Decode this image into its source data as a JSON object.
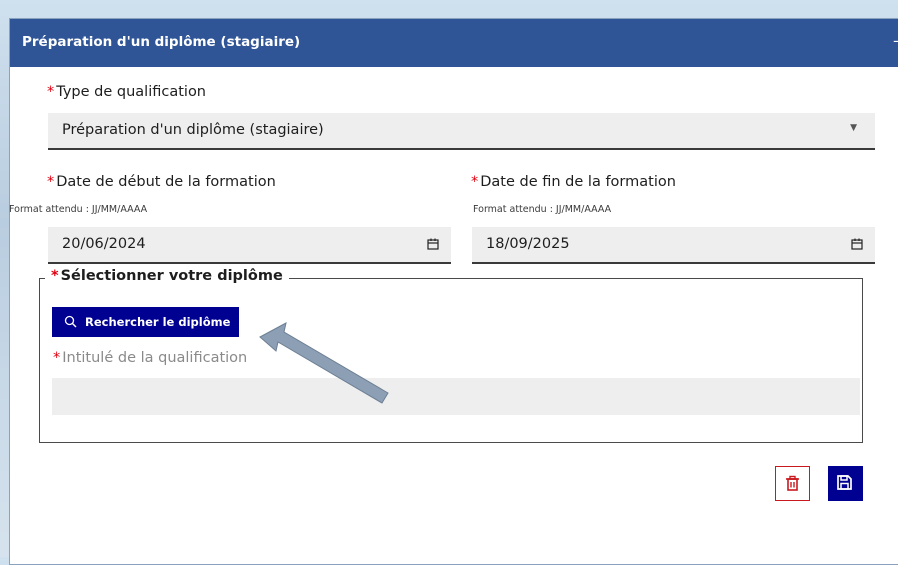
{
  "panel": {
    "title": "Préparation d'un diplôme (stagiaire)",
    "collapse_symbol": "–"
  },
  "form": {
    "required_marker": "*",
    "qualification_type": {
      "label": "Type de qualification",
      "value": "Préparation d'un diplôme (stagiaire)"
    },
    "start_date": {
      "label": "Date de début de la formation",
      "hint": "Format attendu : JJ/MM/AAAA",
      "value": "20/06/2024"
    },
    "end_date": {
      "label": "Date de fin de la formation",
      "hint": "Format attendu : JJ/MM/AAAA",
      "value": "18/09/2025"
    },
    "diploma_group": {
      "legend": "Sélectionner votre diplôme",
      "search_button": "Rechercher le diplôme",
      "intitule_label": "Intitulé de la qualification",
      "intitule_value": ""
    }
  },
  "actions": {
    "delete_icon": "trash-icon",
    "save_icon": "floppy-disk-icon"
  },
  "colors": {
    "header": "#2f5597",
    "primary": "#000091",
    "danger": "#c9191e",
    "required": "#e1000f"
  }
}
